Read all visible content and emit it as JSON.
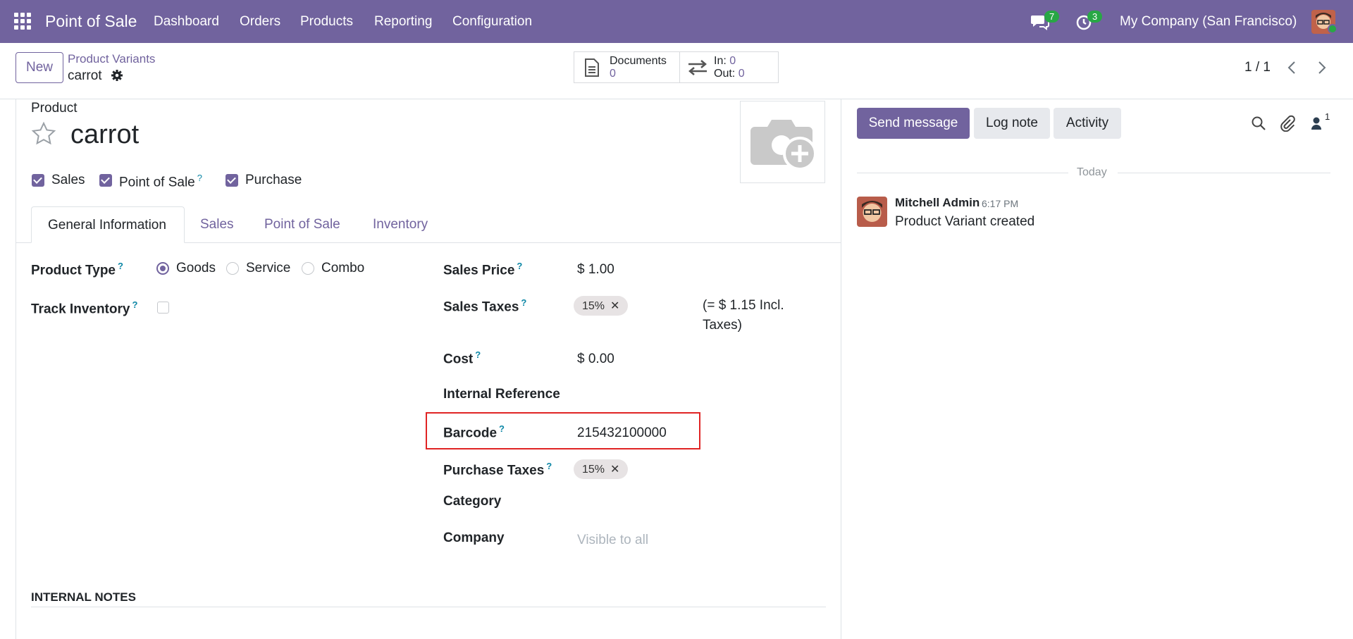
{
  "navbar": {
    "app_name": "Point of Sale",
    "menu": [
      "Dashboard",
      "Orders",
      "Products",
      "Reporting",
      "Configuration"
    ],
    "messages_count": "7",
    "activities_count": "3",
    "company": "My Company (San Francisco)",
    "colors": {
      "brand": "#71639e",
      "badge": "#28a745"
    }
  },
  "control_panel": {
    "new_label": "New",
    "breadcrumb_parent": "Product Variants",
    "record_name": "carrot",
    "documents_label": "Documents",
    "documents_count": "0",
    "in_label": "In:",
    "in_count": "0",
    "out_label": "Out:",
    "out_count": "0",
    "pager": "1 / 1"
  },
  "form": {
    "product_label": "Product",
    "product_name": "carrot",
    "checkboxes": {
      "sales": "Sales",
      "pos": "Point of Sale",
      "purchase": "Purchase"
    },
    "tabs": [
      "General Information",
      "Sales",
      "Point of Sale",
      "Inventory"
    ],
    "product_type_label": "Product Type",
    "product_type_options": [
      "Goods",
      "Service",
      "Combo"
    ],
    "track_inventory_label": "Track Inventory",
    "sales_price_label": "Sales Price",
    "sales_price": "$ 1.00",
    "sales_taxes_label": "Sales Taxes",
    "sales_tax_tag": "15%",
    "incl_taxes_note": "(= $ 1.15 Incl. Taxes)",
    "cost_label": "Cost",
    "cost": "$ 0.00",
    "internal_ref_label": "Internal Reference",
    "barcode_label": "Barcode",
    "barcode": "215432100000",
    "purchase_taxes_label": "Purchase Taxes",
    "purchase_tax_tag": "15%",
    "category_label": "Category",
    "company_label": "Company",
    "company_placeholder": "Visible to all",
    "internal_notes_label": "INTERNAL NOTES",
    "help_mark": "?"
  },
  "chatter": {
    "send_message": "Send message",
    "log_note": "Log note",
    "activity": "Activity",
    "followers_count": "1",
    "date_separator": "Today",
    "author": "Mitchell Admin",
    "time": "6:17 PM",
    "message": "Product Variant created"
  }
}
